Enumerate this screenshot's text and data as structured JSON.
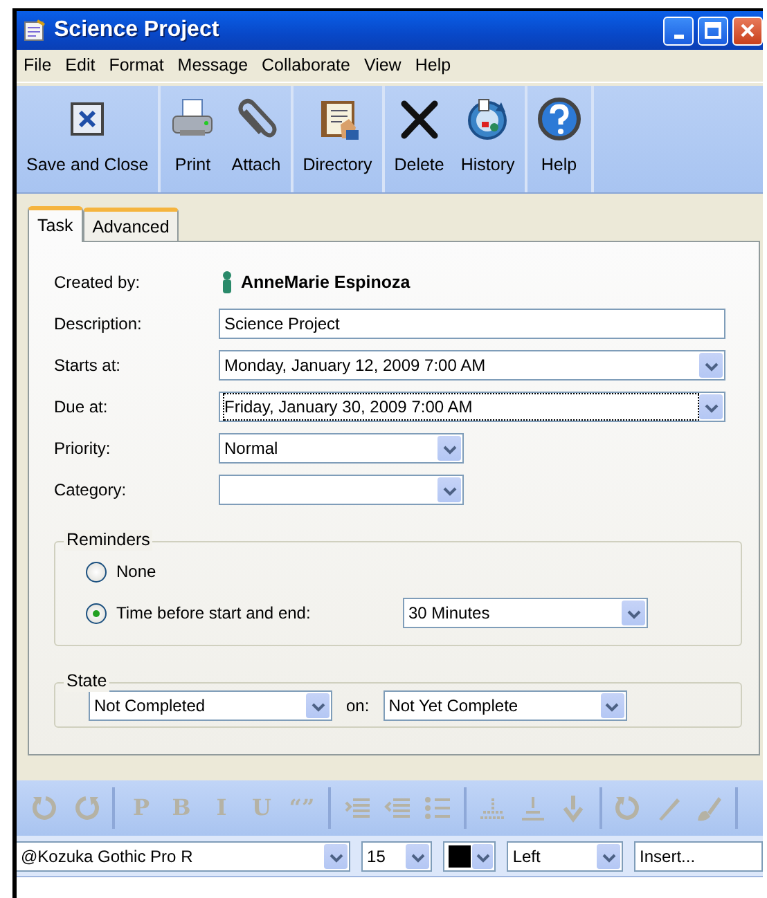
{
  "window": {
    "title": "Science Project"
  },
  "menu": [
    "File",
    "Edit",
    "Format",
    "Message",
    "Collaborate",
    "View",
    "Help"
  ],
  "toolbar": [
    {
      "buttons": [
        {
          "label": "Save and Close",
          "kind": "save"
        }
      ]
    },
    {
      "buttons": [
        {
          "label": "Print",
          "kind": "print"
        },
        {
          "label": "Attach",
          "kind": "attach"
        }
      ]
    },
    {
      "buttons": [
        {
          "label": "Directory",
          "kind": "directory"
        }
      ]
    },
    {
      "buttons": [
        {
          "label": "Delete",
          "kind": "delete"
        },
        {
          "label": "History",
          "kind": "history"
        }
      ]
    },
    {
      "buttons": [
        {
          "label": "Help",
          "kind": "help"
        }
      ]
    }
  ],
  "tabs": [
    {
      "label": "Task",
      "selected": true
    },
    {
      "label": "Advanced",
      "selected": false
    }
  ],
  "created_by": {
    "label": "Created by:",
    "value": "AnneMarie Espinoza"
  },
  "fields": [
    {
      "label": "Description:",
      "kind": "text",
      "value": "Science Project",
      "focused": false
    },
    {
      "label": "Starts at:",
      "kind": "date",
      "value": "Monday, January 12, 2009 7:00 AM",
      "focused": false
    },
    {
      "label": "Due at:",
      "kind": "date",
      "value": "Friday, January 30, 2009 7:00 AM",
      "focused": true
    },
    {
      "label": "Priority:",
      "kind": "select",
      "value": "Normal",
      "focused": false
    },
    {
      "label": "Category:",
      "kind": "select",
      "focused": false
    }
  ],
  "reminders": {
    "title": "Reminders",
    "options": [
      {
        "label": "None",
        "selected": false
      },
      {
        "label": "Time before start and end:",
        "selected": true
      }
    ],
    "duration": "30 Minutes"
  },
  "state": {
    "title": "State",
    "status": "Not Completed",
    "on_label": "on:",
    "date": "Not Yet Complete"
  },
  "format_toolbar": [
    {
      "buttons": [
        {
          "kind": "undo",
          "disabled": true
        },
        {
          "kind": "redo",
          "disabled": true
        }
      ]
    },
    {
      "buttons": [
        {
          "kind": "glyph",
          "glyph": "P",
          "disabled": true
        },
        {
          "kind": "glyph",
          "glyph": "B",
          "disabled": true
        },
        {
          "kind": "glyph",
          "glyph": "I",
          "disabled": true
        },
        {
          "kind": "glyph",
          "glyph": "U",
          "disabled": true
        },
        {
          "kind": "glyph",
          "glyph": "“”",
          "disabled": true
        }
      ]
    },
    {
      "buttons": [
        {
          "kind": "indent",
          "disabled": true
        },
        {
          "kind": "outdent",
          "disabled": true
        },
        {
          "kind": "bullets",
          "disabled": true
        }
      ]
    },
    {
      "buttons": [
        {
          "kind": "table",
          "disabled": true
        },
        {
          "kind": "rule",
          "disabled": true
        },
        {
          "kind": "down",
          "disabled": true
        }
      ]
    },
    {
      "buttons": [
        {
          "kind": "undo",
          "disabled": true
        },
        {
          "kind": "pen",
          "disabled": true
        },
        {
          "kind": "brush",
          "disabled": true
        }
      ]
    }
  ],
  "font_bar": {
    "font": "@Kozuka Gothic Pro R",
    "size": "15",
    "color": "#000000",
    "align": "Left",
    "insert": "Insert..."
  }
}
